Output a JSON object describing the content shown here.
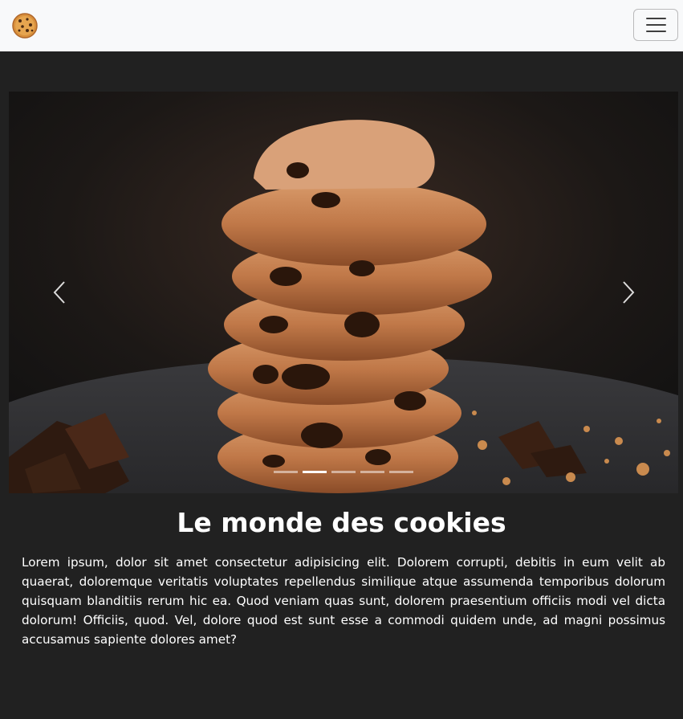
{
  "navbar": {
    "brand_icon": "cookie-icon",
    "toggler_icon": "hamburger-menu-icon"
  },
  "carousel": {
    "slide_image": "stack-of-chocolate-chip-cookies",
    "prev_icon": "chevron-left-icon",
    "next_icon": "chevron-right-icon",
    "indicator_count": 5,
    "active_indicator": 2
  },
  "content": {
    "title": "Le monde des cookies",
    "paragraph": "Lorem ipsum, dolor sit amet consectetur adipisicing elit. Dolorem corrupti, debitis in eum velit ab quaerat, doloremque veritatis voluptates repellendus similique atque assumenda temporibus dolorum quisquam blanditiis rerum hic ea. Quod veniam quas sunt, dolorem praesentium officiis modi vel dicta dolorum! Officiis, quod. Vel, dolore quod est sunt esse a commodi quidem unde, ad magni possimus accusamus sapiente dolores amet?"
  },
  "colors": {
    "page_background": "#212121",
    "navbar_background": "#f8f9fa",
    "text": "#ffffff"
  }
}
